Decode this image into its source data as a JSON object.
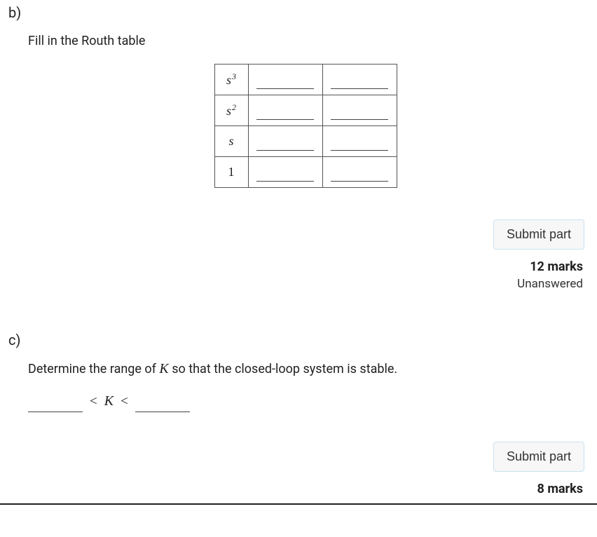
{
  "partB": {
    "label": "b)",
    "question": "Fill in the Routh table",
    "rows": [
      {
        "labelBase": "s",
        "labelSup": "3"
      },
      {
        "labelBase": "s",
        "labelSup": "2"
      },
      {
        "labelBase": "s",
        "labelSup": ""
      },
      {
        "labelBase": "1",
        "labelSup": ""
      }
    ],
    "submitLabel": "Submit part",
    "marks": "12 marks",
    "status": "Unanswered"
  },
  "partC": {
    "label": "c)",
    "questionPrefix": "Determine the range of ",
    "questionVar": "K",
    "questionSuffix": " so that the closed-loop system is stable.",
    "lt1": "<",
    "var": "K",
    "lt2": "<",
    "submitLabel": "Submit part",
    "marks": "8 marks"
  }
}
